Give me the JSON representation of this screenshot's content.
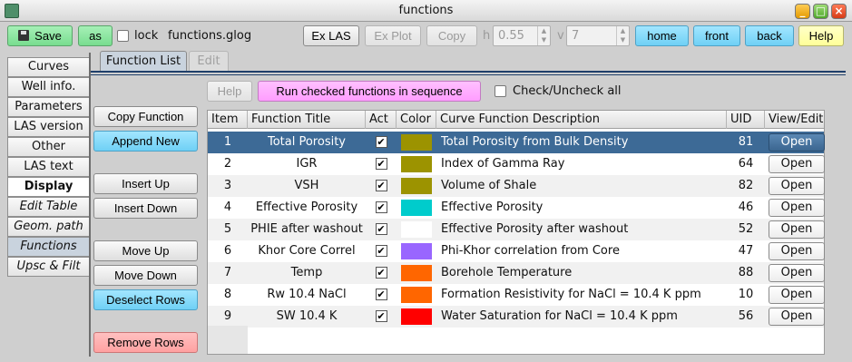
{
  "window": {
    "title": "functions"
  },
  "toolbar": {
    "save_label": "Save",
    "as_label": "as",
    "lock_label": "lock",
    "filename": "functions.glog",
    "exlas_label": "Ex LAS",
    "explot_label": "Ex Plot",
    "copy_label": "Copy",
    "h_label": "h",
    "h_value": "0.55",
    "v_label": "v",
    "v_value": "7",
    "home_label": "home",
    "front_label": "front",
    "back_label": "back",
    "help_label": "Help"
  },
  "sidebar": {
    "items": [
      {
        "label": "Curves"
      },
      {
        "label": "Well info."
      },
      {
        "label": "Parameters"
      },
      {
        "label": "LAS version"
      },
      {
        "label": "Other"
      },
      {
        "label": "LAS text"
      },
      {
        "label": "Display"
      },
      {
        "label": "Edit Table"
      },
      {
        "label": "Geom. path"
      },
      {
        "label": "Functions"
      },
      {
        "label": "Upsc & Filt"
      }
    ]
  },
  "tabs": {
    "function_list": "Function List",
    "edit": "Edit"
  },
  "actions": {
    "help": "Help",
    "run": "Run checked functions in sequence",
    "check_all": "Check/Uncheck all",
    "copy_function": "Copy Function",
    "append_new": "Append New",
    "insert_up": "Insert Up",
    "insert_down": "Insert Down",
    "move_up": "Move Up",
    "move_down": "Move Down",
    "deselect_rows": "Deselect Rows",
    "remove_rows": "Remove Rows"
  },
  "table": {
    "headers": [
      "Item",
      "Function Title",
      "Act",
      "Color",
      "Curve Function Description",
      "UID",
      "View/Edit"
    ],
    "rows": [
      {
        "item": "1",
        "title": "Total Porosity",
        "act": "✔",
        "color": "#9c9300",
        "desc": "Total Porosity from Bulk Density",
        "uid": "81",
        "view": "Open"
      },
      {
        "item": "2",
        "title": "IGR",
        "act": "✔",
        "color": "#9c9300",
        "desc": "Index of Gamma Ray",
        "uid": "64",
        "view": "Open"
      },
      {
        "item": "3",
        "title": "VSH",
        "act": "✔",
        "color": "#9c9300",
        "desc": "Volume of Shale",
        "uid": "82",
        "view": "Open"
      },
      {
        "item": "4",
        "title": "Effective Porosity",
        "act": "✔",
        "color": "#00cccc",
        "desc": "Effective Porosity",
        "uid": "46",
        "view": "Open"
      },
      {
        "item": "5",
        "title": "PHIE after washout",
        "act": "✔",
        "color": "#ffffff",
        "desc": "Effective Porosity after washout",
        "uid": "52",
        "view": "Open"
      },
      {
        "item": "6",
        "title": "Khor Core Correl",
        "act": "✔",
        "color": "#9966ff",
        "desc": "Phi-Khor correlation from Core",
        "uid": "47",
        "view": "Open"
      },
      {
        "item": "7",
        "title": "Temp",
        "act": "✔",
        "color": "#ff6600",
        "desc": "Borehole Temperature",
        "uid": "88",
        "view": "Open"
      },
      {
        "item": "8",
        "title": "Rw 10.4 NaCl",
        "act": "✔",
        "color": "#ff6600",
        "desc": "Formation Resistivity for NaCl = 10.4 K ppm",
        "uid": "10",
        "view": "Open"
      },
      {
        "item": "9",
        "title": "SW 10.4 K",
        "act": "✔",
        "color": "#ff0000",
        "desc": "Water Saturation for NaCl = 10.4 K ppm",
        "uid": "56",
        "view": "Open"
      }
    ]
  }
}
